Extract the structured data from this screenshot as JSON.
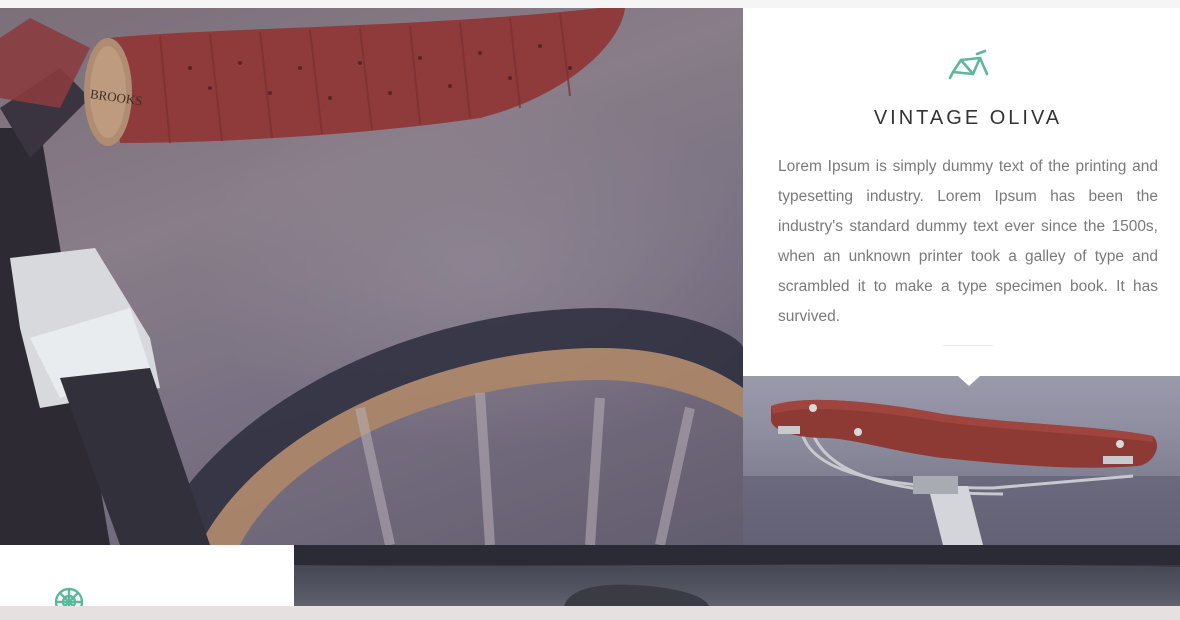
{
  "feature": {
    "title": "VINTAGE OLIVA",
    "body": "Lorem Ipsum is simply dummy text of the printing and typesetting industry. Lorem Ipsum has been the industry's standard dummy text ever since the 1500s, when an unknown printer took a galley of type and scrambled it to make a type specimen book. It has survived.",
    "icon": "bike-frame-icon"
  },
  "photos": {
    "hero": {
      "subject": "handlebar-grip",
      "brand_stamp": "BROOKS"
    },
    "saddle": {
      "subject": "leather-saddle"
    },
    "bottom": {
      "subject": "bike-detail"
    }
  },
  "next_feature": {
    "icon": "wheel-icon"
  },
  "colors": {
    "accent": "#5cb89a",
    "title": "#333333",
    "body_text": "#7a7a7a",
    "grip": "#8e3a3a"
  }
}
